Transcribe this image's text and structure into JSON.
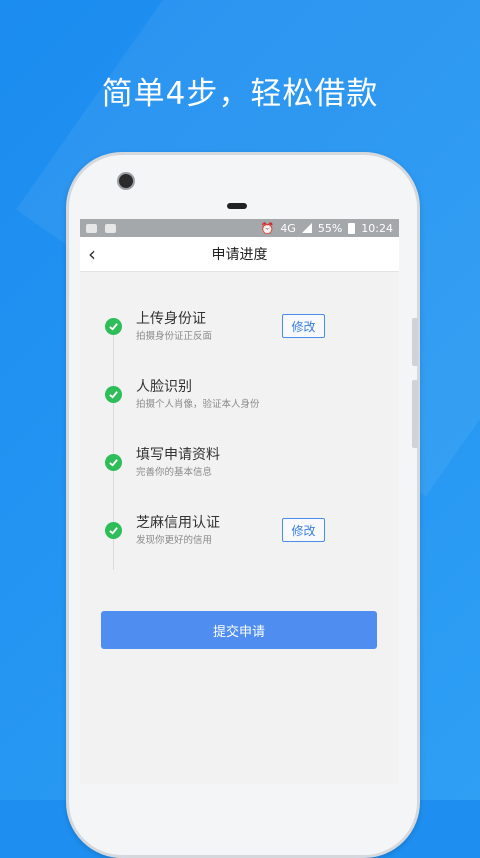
{
  "headline": "简单4步，轻松借款",
  "status_bar": {
    "network": "4G",
    "battery": "55%",
    "time": "10:24"
  },
  "nav": {
    "title": "申请进度",
    "back_icon": "chevron-left-icon"
  },
  "steps": [
    {
      "title": "上传身份证",
      "subtitle": "拍摄身份证正反面",
      "action_label": "修改",
      "done": true
    },
    {
      "title": "人脸识别",
      "subtitle": "拍摄个人肖像，验证本人身份",
      "done": true
    },
    {
      "title": "填写申请资料",
      "subtitle": "完善你的基本信息",
      "done": true
    },
    {
      "title": "芝麻信用认证",
      "subtitle": "发现你更好的信用",
      "action_label": "修改",
      "done": true
    }
  ],
  "submit_label": "提交申请",
  "colors": {
    "background": "#1e8ff0",
    "accent": "#4f8ef0",
    "check": "#2ebd59"
  }
}
